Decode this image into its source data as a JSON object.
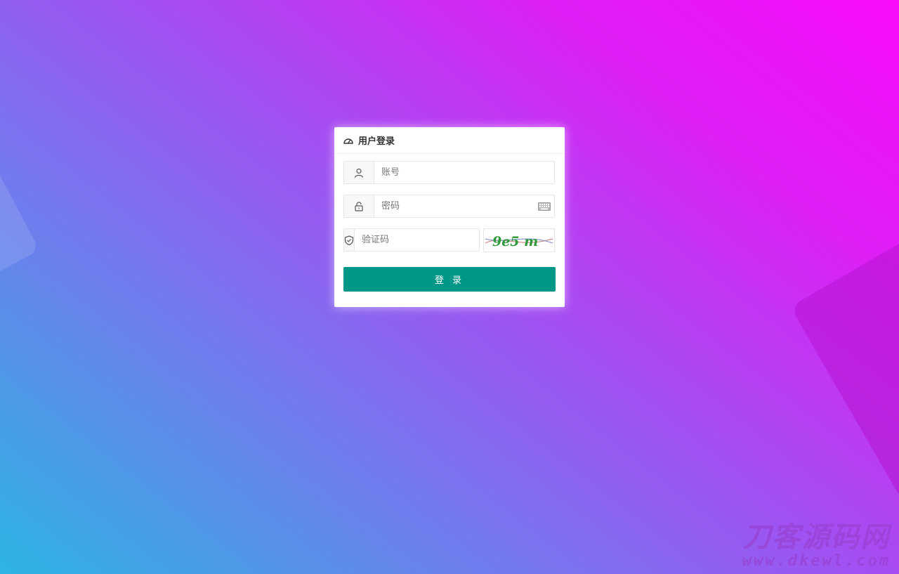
{
  "login": {
    "title": "用户登录",
    "username_placeholder": "账号",
    "password_placeholder": "密码",
    "captcha_placeholder": "验证码",
    "captcha_text": "9e5 m",
    "submit_label": "登 录"
  },
  "watermark": {
    "brand": "刀客源码网",
    "url": "www.dkewl.com"
  },
  "icons": {
    "header": "dashboard-icon",
    "username": "user-icon",
    "password": "lock-icon",
    "captcha": "shield-icon",
    "keyboard": "keyboard-icon"
  },
  "colors": {
    "primary_button": "#009688",
    "gradient_start": "#2cb5e2",
    "gradient_end": "#f90cfa"
  }
}
